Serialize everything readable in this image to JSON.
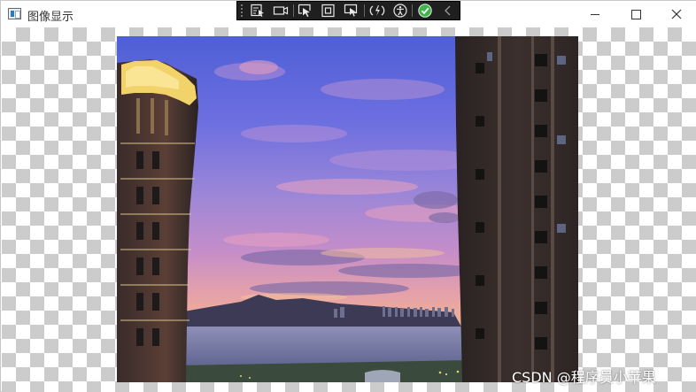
{
  "window": {
    "title": "图像显示"
  },
  "toolbar": {
    "buttons": [
      {
        "icon": "select-region-icon"
      },
      {
        "icon": "camera-icon"
      },
      {
        "icon": "pointer-select-icon"
      },
      {
        "icon": "frame-icon"
      },
      {
        "icon": "pointer-frame-icon"
      },
      {
        "icon": "hot-reload-icon"
      },
      {
        "icon": "accessibility-icon"
      },
      {
        "icon": "check-circle-icon"
      },
      {
        "icon": "collapse-chevron-icon"
      }
    ],
    "check_color": "#3db54a"
  },
  "image": {
    "subject": "sunset-sky-between-buildings"
  },
  "watermark": {
    "text": "CSDN @程序员小苹果"
  }
}
